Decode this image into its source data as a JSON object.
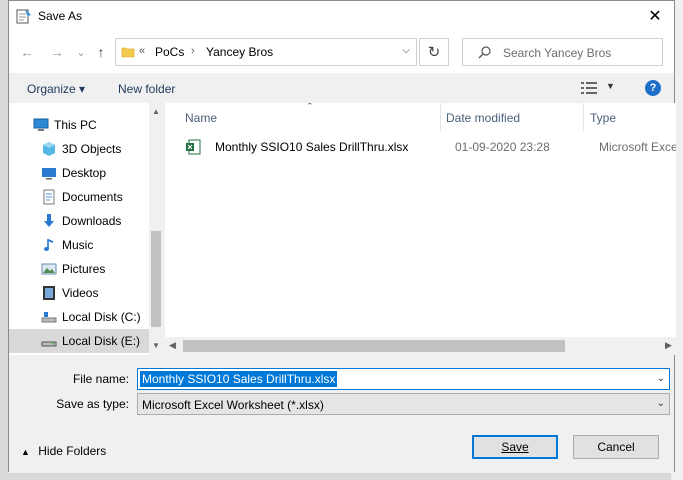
{
  "window": {
    "title": "Save As",
    "close_glyph": "✕"
  },
  "nav": {
    "back_glyph": "←",
    "forward_glyph": "→",
    "recent_glyph": "⌄",
    "up_glyph": "↑",
    "address": {
      "overflow": "«",
      "crumbs": [
        "PoCs",
        "Yancey Bros"
      ],
      "separator": "›"
    },
    "refresh_glyph": "↻",
    "search_placeholder": "Search Yancey Bros"
  },
  "toolbar": {
    "organize": "Organize ▾",
    "new_folder": "New folder",
    "help": "?"
  },
  "sidebar": {
    "items": [
      {
        "label": "This PC",
        "icon": "pc-icon",
        "selected": false
      },
      {
        "label": "3D Objects",
        "icon": "3d-objects-icon",
        "selected": false
      },
      {
        "label": "Desktop",
        "icon": "desktop-icon",
        "selected": false
      },
      {
        "label": "Documents",
        "icon": "documents-icon",
        "selected": false
      },
      {
        "label": "Downloads",
        "icon": "downloads-icon",
        "selected": false
      },
      {
        "label": "Music",
        "icon": "music-icon",
        "selected": false
      },
      {
        "label": "Pictures",
        "icon": "pictures-icon",
        "selected": false
      },
      {
        "label": "Videos",
        "icon": "videos-icon",
        "selected": false
      },
      {
        "label": "Local Disk (C:)",
        "icon": "drive-c-icon",
        "selected": false
      },
      {
        "label": "Local Disk (E:)",
        "icon": "drive-e-icon",
        "selected": true
      }
    ]
  },
  "file_list": {
    "columns": [
      "Name",
      "Date modified",
      "Type"
    ],
    "files": [
      {
        "name": "Monthly SSIO10 Sales DrillThru.xlsx",
        "date_modified": "01-09-2020 23:28",
        "type": "Microsoft Excel W"
      }
    ]
  },
  "form": {
    "file_name_label": "File name:",
    "file_name_value": "Monthly SSIO10 Sales DrillThru.xlsx",
    "save_type_label": "Save as type:",
    "save_type_value": "Microsoft Excel Worksheet (*.xlsx)"
  },
  "footer": {
    "hide_folders": "Hide Folders",
    "save": "Save",
    "cancel": "Cancel"
  },
  "colors": {
    "accent": "#0078d7",
    "selected_bg": "#d9d9d9",
    "excel_green": "#1d6f42"
  }
}
